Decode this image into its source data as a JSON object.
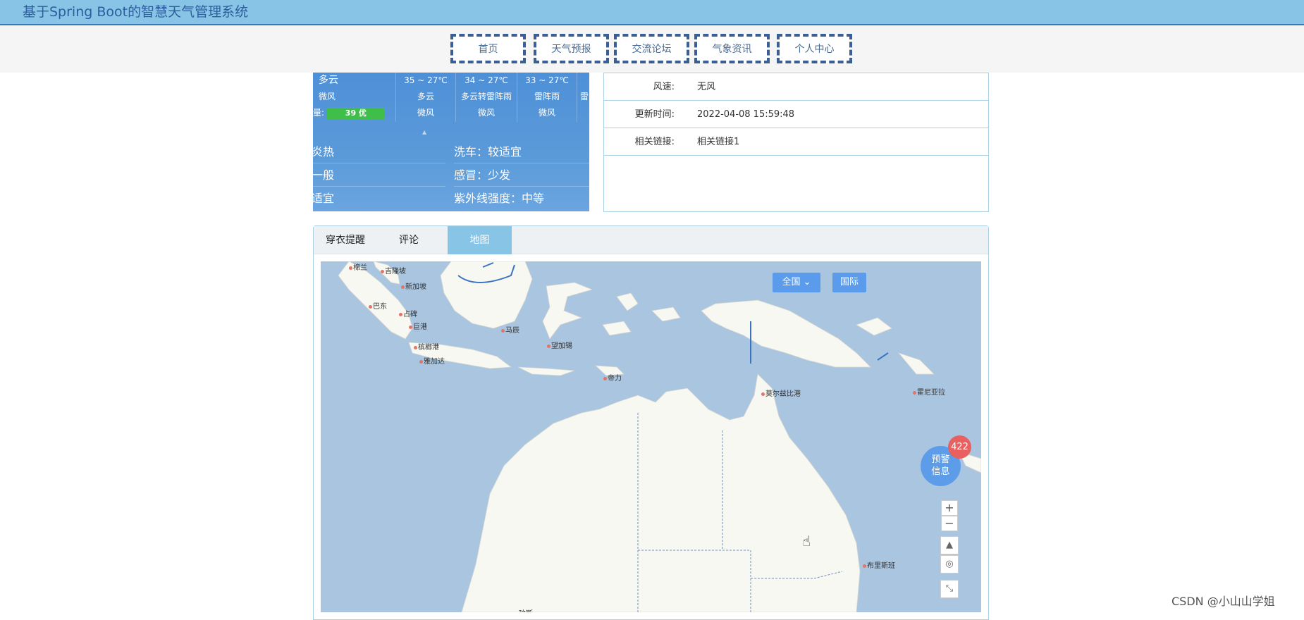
{
  "header": {
    "title": "基于Spring Boot的智慧天气管理系统"
  },
  "nav": {
    "items": [
      {
        "label": "首页"
      },
      {
        "label": "天气预报"
      },
      {
        "label": "交流论坛"
      },
      {
        "label": "气象资讯"
      },
      {
        "label": "个人中心"
      }
    ]
  },
  "weather": {
    "today": {
      "condition": "多云",
      "wind": "微风",
      "aqi_prefix": "量:",
      "aqi_value": "39 优"
    },
    "forecast": [
      {
        "temp": "35 ~ 27℃",
        "condition": "多云",
        "wind": "微风"
      },
      {
        "temp": "34 ~ 27℃",
        "condition": "多云转雷阵雨",
        "wind": "微风"
      },
      {
        "temp": "33 ~ 27℃",
        "condition": "雷阵雨",
        "wind": "微风"
      },
      {
        "temp": "",
        "condition": "雷",
        "wind": ""
      }
    ],
    "indices": [
      {
        "text": "炎热"
      },
      {
        "text": "洗车：较适宜"
      },
      {
        "text": "一般"
      },
      {
        "text": "感冒：少发"
      },
      {
        "text": "适宜"
      },
      {
        "text": "紫外线强度：中等"
      }
    ]
  },
  "info": {
    "rows": [
      {
        "label": "风速:",
        "value": "无风"
      },
      {
        "label": "更新时间:",
        "value": "2022-04-08 15:59:48"
      },
      {
        "label": "相关链接:",
        "value": "相关链接1"
      }
    ]
  },
  "tabs": [
    {
      "label": "穿衣提醒",
      "active": false
    },
    {
      "label": "评论",
      "active": false
    },
    {
      "label": "地图",
      "active": true
    }
  ],
  "map": {
    "region_button": "全国",
    "intl_button": "国际",
    "warning_label_line1": "预警",
    "warning_label_line2": "信息",
    "warning_count": "422",
    "zoom_in": "+",
    "zoom_out": "−",
    "cities": [
      {
        "name": "棉兰"
      },
      {
        "name": "吉隆坡"
      },
      {
        "name": "新加坡"
      },
      {
        "name": "巴东"
      },
      {
        "name": "占碑"
      },
      {
        "name": "巨港"
      },
      {
        "name": "马辰"
      },
      {
        "name": "望加锡"
      },
      {
        "name": "槟榔港"
      },
      {
        "name": "雅加达"
      },
      {
        "name": "帝力"
      },
      {
        "name": "莫尔兹比港"
      },
      {
        "name": "霍尼亚拉"
      },
      {
        "name": "布里斯班"
      },
      {
        "name": "珀斯"
      }
    ]
  },
  "watermark": "CSDN @小山山学姐",
  "colors": {
    "header_bg": "#87c4e6",
    "nav_border": "#3b5e95",
    "tab_active": "#87c4e6",
    "sea": "#aac5e0",
    "land": "#f8f8f2",
    "badge": "#e96060"
  }
}
